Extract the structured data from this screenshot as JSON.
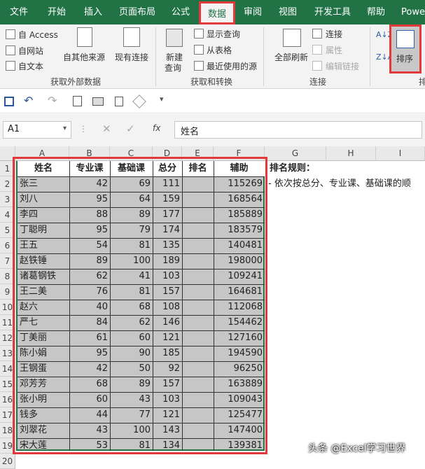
{
  "ribbon": {
    "tabs": [
      "文件",
      "开始",
      "插入",
      "页面布局",
      "公式",
      "数据",
      "审阅",
      "视图",
      "开发工具",
      "帮助",
      "Powe"
    ],
    "active_tab": "数据",
    "get_external": {
      "access": "自 Access",
      "web": "自网站",
      "text": "自文本",
      "other": "自其他来源",
      "existing": "现有连接",
      "group": "获取外部数据"
    },
    "get_transform": {
      "new_query": "新建",
      "new_query2": "查询",
      "show_queries": "显示查询",
      "from_table": "从表格",
      "recent": "最近使用的源",
      "group": "获取和转换"
    },
    "connections": {
      "refresh_all": "全部刷新",
      "connections": "连接",
      "properties": "属性",
      "edit_links": "编辑链接",
      "group": "连接"
    },
    "sort": {
      "label": "排序",
      "group": "排"
    }
  },
  "formula_bar": {
    "name_box": "A1",
    "fx": "fx",
    "content": "姓名"
  },
  "sheet": {
    "columns": [
      "A",
      "B",
      "C",
      "D",
      "E",
      "F",
      "G",
      "H",
      "I"
    ],
    "rows": [
      "1",
      "2",
      "3",
      "4",
      "5",
      "6",
      "7",
      "8",
      "9",
      "10",
      "11",
      "12",
      "13",
      "14",
      "15",
      "16",
      "17",
      "18",
      "19",
      "20"
    ],
    "headers": [
      "姓名",
      "专业课",
      "基础课",
      "总分",
      "排名",
      "辅助"
    ],
    "data": [
      [
        "张三",
        "42",
        "69",
        "111",
        "",
        "115269"
      ],
      [
        "刘八",
        "95",
        "64",
        "159",
        "",
        "168564"
      ],
      [
        "李四",
        "88",
        "89",
        "177",
        "",
        "185889"
      ],
      [
        "丁聪明",
        "95",
        "79",
        "174",
        "",
        "183579"
      ],
      [
        "王五",
        "54",
        "81",
        "135",
        "",
        "140481"
      ],
      [
        "赵铁锤",
        "89",
        "100",
        "189",
        "",
        "198000"
      ],
      [
        "诸葛钢铁",
        "62",
        "41",
        "103",
        "",
        "109241"
      ],
      [
        "王二美",
        "76",
        "81",
        "157",
        "",
        "164681"
      ],
      [
        "赵六",
        "40",
        "68",
        "108",
        "",
        "112068"
      ],
      [
        "严七",
        "84",
        "62",
        "146",
        "",
        "154462"
      ],
      [
        "丁美丽",
        "61",
        "60",
        "121",
        "",
        "127160"
      ],
      [
        "陈小娟",
        "95",
        "90",
        "185",
        "",
        "194590"
      ],
      [
        "王钢蛋",
        "42",
        "50",
        "92",
        "",
        "96250"
      ],
      [
        "邓芳芳",
        "68",
        "89",
        "157",
        "",
        "163889"
      ],
      [
        "张小明",
        "60",
        "43",
        "103",
        "",
        "109043"
      ],
      [
        "钱多",
        "44",
        "77",
        "121",
        "",
        "125477"
      ],
      [
        "刘翠花",
        "43",
        "100",
        "143",
        "",
        "147400"
      ],
      [
        "宋大莲",
        "53",
        "81",
        "134",
        "",
        "139381"
      ]
    ],
    "rule_title": "排名规则：",
    "rule_text": "- 依次按总分、专业课、基础课的顺"
  },
  "watermark": "头条 @Excel学习世界",
  "colors": {
    "accent": "#217346",
    "highlight": "#e03a3a",
    "table_fill": "#c6c6c6"
  }
}
